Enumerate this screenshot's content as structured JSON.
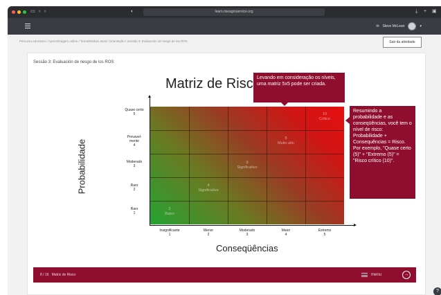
{
  "browser": {
    "url": "learn.riseagroservice.org",
    "traffic_colors": [
      "#ff5f57",
      "#febc2e",
      "#28c840"
    ]
  },
  "appbar": {
    "user_name": "Steve McLean"
  },
  "breadcrumb": "Percurso educativo  /  Aprendizagem online  /  Tema/Módulo atual  /  Orientação  /  Sessão 3: Evaluación de riesgo de los ROS",
  "exit_button": "Sair da atividade",
  "card_title": "Sessão 3: Evaluación de riesgo de los ROS",
  "slide": {
    "title": "Matriz de Risco",
    "ylabel": "Probabilidade",
    "xlabel": "Conseqüências",
    "y_ticks": [
      {
        "label": "Quase certo",
        "num": "5"
      },
      {
        "label": "Provavel-mente",
        "num": "4"
      },
      {
        "label": "Moderado",
        "num": "3"
      },
      {
        "label": "Raro",
        "num": "2"
      },
      {
        "label": "Raro",
        "num": "1"
      }
    ],
    "x_ticks": [
      {
        "label": "Insignificante",
        "num": "1"
      },
      {
        "label": "Menor",
        "num": "2"
      },
      {
        "label": "Moderado",
        "num": "3"
      },
      {
        "label": "Maior",
        "num": "4"
      },
      {
        "label": "Extremo",
        "num": "5"
      }
    ],
    "cells": [
      {
        "value": "2",
        "label": "Baixo"
      },
      {
        "value": "4",
        "label": "Significativo"
      },
      {
        "value": "9",
        "label": "Significativo"
      },
      {
        "value": "8",
        "label": "Muito alto"
      },
      {
        "value": "10",
        "label": "Crítico"
      }
    ],
    "callout_top": "Levando em consideração os níveis, uma matriz 5x5 pode ser criada.",
    "callout_right": "Resumindo a probabilidade e as conseqüências, você tem o nível de risco: Probabilidade + Consequências = Risco. Por exemplo, \"Quase certo (5)\" + \"Extremo (5)\" = \"Risco crítico (10)\"."
  },
  "navbar": {
    "progress": "8 / 16",
    "slide_name": "Matriz de Risco",
    "menu_label": "menu"
  },
  "colors": {
    "accent": "#8f0e2f",
    "appbar": "#3a3c43"
  }
}
